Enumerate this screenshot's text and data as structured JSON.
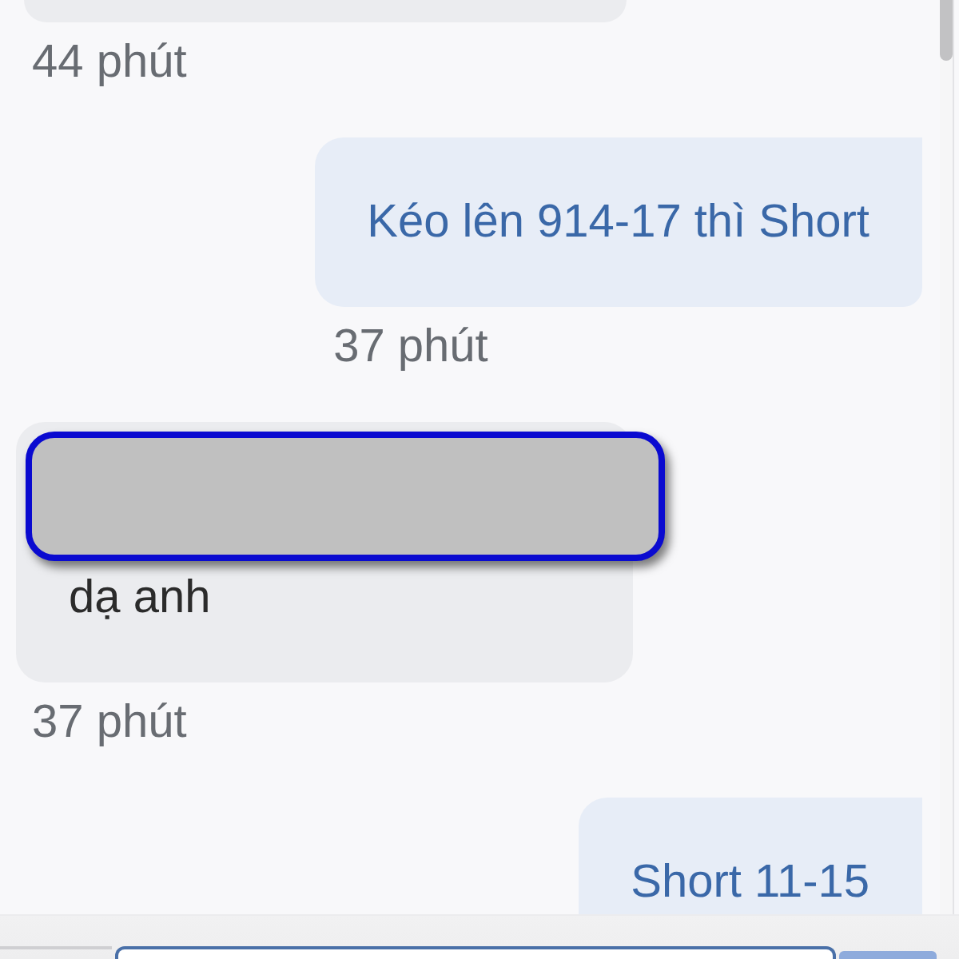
{
  "messages": [
    {
      "kind": "received",
      "redacted": false,
      "time": "44 phút"
    },
    {
      "kind": "sent",
      "text": "Kéo lên 914-17 thì Short",
      "redacted": false,
      "time": "37 phút"
    },
    {
      "kind": "received",
      "text": "dạ anh",
      "redacted": true,
      "time": "37 phút"
    },
    {
      "kind": "sent",
      "text": "Short 11-15",
      "redacted": false
    }
  ]
}
